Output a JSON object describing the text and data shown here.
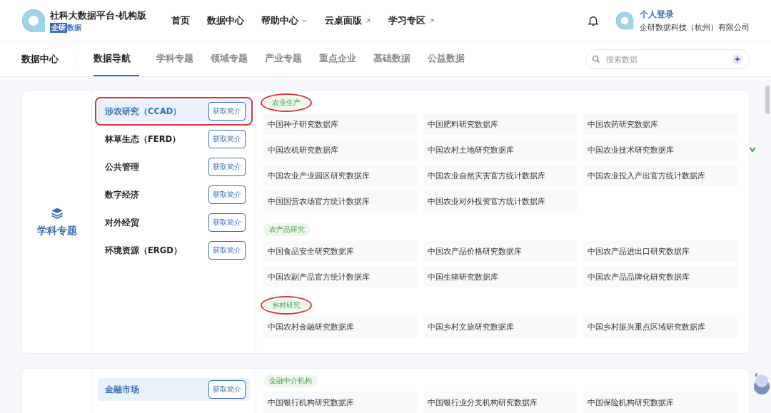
{
  "header": {
    "brand_title": "社科大数据平台-机构版",
    "brand_badge": "企研",
    "brand_sub": "数据",
    "nav": [
      {
        "label": "首页",
        "kind": "plain"
      },
      {
        "label": "数据中心",
        "kind": "plain"
      },
      {
        "label": "帮助中心",
        "kind": "dropdown"
      },
      {
        "label": "云桌面版",
        "kind": "external"
      },
      {
        "label": "学习专区",
        "kind": "external"
      }
    ],
    "user": {
      "name": "个人登录",
      "org": "企研数据科技（杭州）有限公司"
    }
  },
  "subnav": {
    "title": "数据中心",
    "tabs": [
      {
        "label": "数据导航",
        "selected": true
      },
      {
        "label": "学科专题",
        "selected": false
      },
      {
        "label": "领域专题",
        "selected": false
      },
      {
        "label": "产业专题",
        "selected": false
      },
      {
        "label": "重点企业",
        "selected": false
      },
      {
        "label": "基础数据",
        "selected": false
      },
      {
        "label": "公益数据",
        "selected": false
      }
    ],
    "search": {
      "placeholder": "搜索数据"
    }
  },
  "sections": [
    {
      "title": "学科专题",
      "items": [
        {
          "label": "涉农研究（CCAD）",
          "button": "获取简介",
          "selected": true,
          "boxed": true
        },
        {
          "label": "林草生态（FERD）",
          "button": "获取简介",
          "selected": false,
          "boxed": false
        },
        {
          "label": "公共管理",
          "button": "获取简介",
          "selected": false,
          "boxed": false
        },
        {
          "label": "数字经济",
          "button": "获取简介",
          "selected": false,
          "boxed": false
        },
        {
          "label": "对外经贸",
          "button": "获取简介",
          "selected": false,
          "boxed": false
        },
        {
          "label": "环境资源（ERGD）",
          "button": "获取简介",
          "selected": false,
          "boxed": false
        }
      ],
      "groups": [
        {
          "tag": "农业生产",
          "circled": true,
          "databases": [
            "中国种子研究数据库",
            "中国肥料研究数据库",
            "中国农药研究数据库",
            "中国农机研究数据库",
            "中国农村土地研究数据库",
            "中国农业技术研究数据库",
            "中国农业产业园区研究数据库",
            "中国农业自然灾害官方统计数据库",
            "中国农业投入产出官方统计数据库",
            "中国国营农场官方统计数据库",
            "中国农业对外投资官方统计数据库"
          ]
        },
        {
          "tag": "农产品研究",
          "circled": false,
          "databases": [
            "中国食品安全研究数据库",
            "中国农产品价格研究数据库",
            "中国农产品进出口研究数据库",
            "中国农副产品官方统计数据库",
            "中国生猪研究数据库",
            "中国农产品品牌化研究数据库"
          ]
        },
        {
          "tag": "乡村研究",
          "circled": true,
          "databases": [
            "中国农村金融研究数据库",
            "中国乡村文旅研究数据库",
            "中国乡村振兴重点区域研究数据库"
          ]
        }
      ]
    },
    {
      "items": [
        {
          "label": "金融市场",
          "button": "获取简介",
          "selected": true,
          "boxed": false
        }
      ],
      "groups": [
        {
          "tag": "金融中介机构",
          "circled": false,
          "databases": [
            "中国银行机构研究数据库",
            "中国银行业分支机构研究数据库",
            "中国保险机构研究数据库"
          ]
        }
      ]
    }
  ]
}
